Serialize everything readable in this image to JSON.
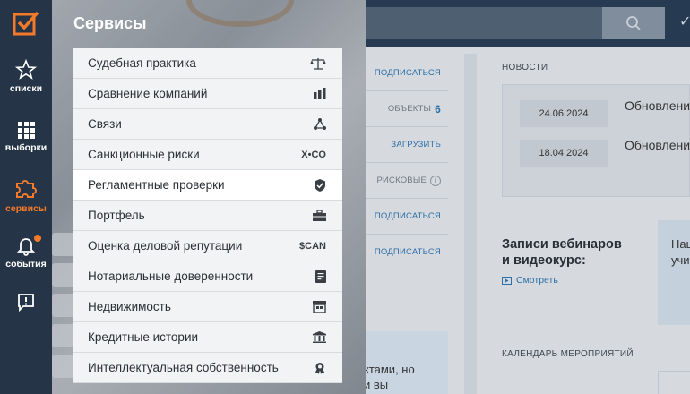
{
  "rail": {
    "items": [
      {
        "label": "списки",
        "icon": "star-icon"
      },
      {
        "label": "выборки",
        "icon": "grid-icon"
      },
      {
        "label": "сервисы",
        "icon": "puzzle-icon"
      },
      {
        "label": "события",
        "icon": "bell-icon"
      },
      {
        "label": "",
        "icon": "feedback-icon"
      }
    ],
    "accent": "#f47a2a"
  },
  "drawer": {
    "title": "Сервисы",
    "items": [
      {
        "label": "Судебная практика",
        "icon": "scales-icon"
      },
      {
        "label": "Сравнение компаний",
        "icon": "bar-chart-icon"
      },
      {
        "label": "Связи",
        "icon": "network-icon"
      },
      {
        "label": "Санкционные риски",
        "icon": "xco-icon",
        "icon_text": "X•CO"
      },
      {
        "label": "Регламентные проверки",
        "icon": "shield-check-icon"
      },
      {
        "label": "Портфель",
        "icon": "briefcase-icon"
      },
      {
        "label": "Оценка деловой репутации",
        "icon": "scan-icon",
        "icon_text": "$CAN"
      },
      {
        "label": "Нотариальные доверенности",
        "icon": "document-icon"
      },
      {
        "label": "Недвижимость",
        "icon": "building-icon"
      },
      {
        "label": "Кредитные истории",
        "icon": "bank-icon"
      },
      {
        "label": "Интеллектуальная собственность",
        "icon": "award-icon"
      }
    ],
    "active_index": 4
  },
  "middle": {
    "rows": [
      {
        "text": "ПОДПИСАТЬСЯ",
        "kind": "link"
      },
      {
        "text": "ОБЪЕКТЫ",
        "kind": "grey",
        "count": "6"
      },
      {
        "text": "ЗАГРУЗИТЬ",
        "kind": "link"
      },
      {
        "text": "РИСКОВЫЕ",
        "kind": "grey",
        "info": "i"
      },
      {
        "text": "ПОДПИСАТЬСЯ",
        "kind": "link"
      },
      {
        "text": "ПОДПИСАТЬСЯ",
        "kind": "link"
      }
    ],
    "promo_text": "ктами, но\nи вы"
  },
  "news": {
    "title": "НОВОСТИ",
    "items": [
      {
        "date": "24.06.2024",
        "text": "Обновлени"
      },
      {
        "date": "18.04.2024",
        "text": "Обновлени"
      }
    ]
  },
  "webinars": {
    "title": "Записи вебинаров\nи видеокурс:",
    "link": "Смотреть",
    "card_text": "Нац\nучи"
  },
  "calendar": {
    "title": "КАЛЕНДАРЬ МЕРОПРИЯТИЙ"
  },
  "header": {
    "check_glyph": "✓"
  }
}
